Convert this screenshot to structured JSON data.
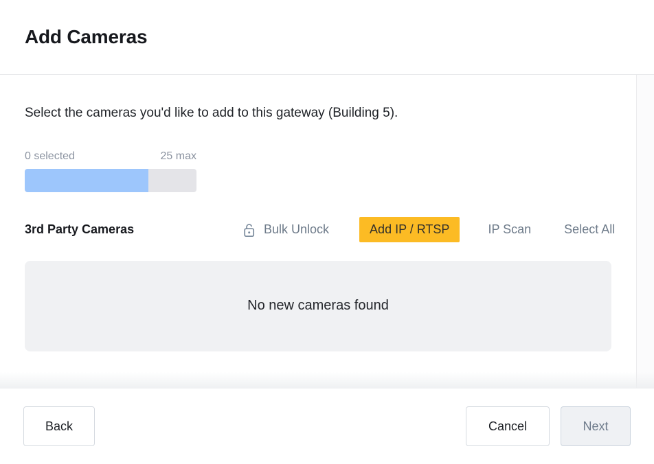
{
  "header": {
    "title": "Add Cameras"
  },
  "main": {
    "intro": "Select the cameras you'd like to add to this gateway (Building 5).",
    "meter": {
      "selected_label": "0 selected",
      "max_label": "25 max",
      "selected_count": 0,
      "max_count": 25,
      "fill_percent": 72,
      "fill_color": "#9dc6fc",
      "track_color": "#e4e4e8"
    },
    "toolbar": {
      "section_title": "3rd Party Cameras",
      "bulk_unlock_label": "Bulk Unlock",
      "bulk_unlock_icon": "open-padlock-icon",
      "add_ip_rtsp_label": "Add IP / RTSP",
      "add_ip_rtsp_color": "#fcbb24",
      "ip_scan_label": "IP Scan",
      "select_all_label": "Select All"
    },
    "empty_state": {
      "message": "No new cameras found"
    }
  },
  "footer": {
    "back_label": "Back",
    "cancel_label": "Cancel",
    "next_label": "Next"
  }
}
